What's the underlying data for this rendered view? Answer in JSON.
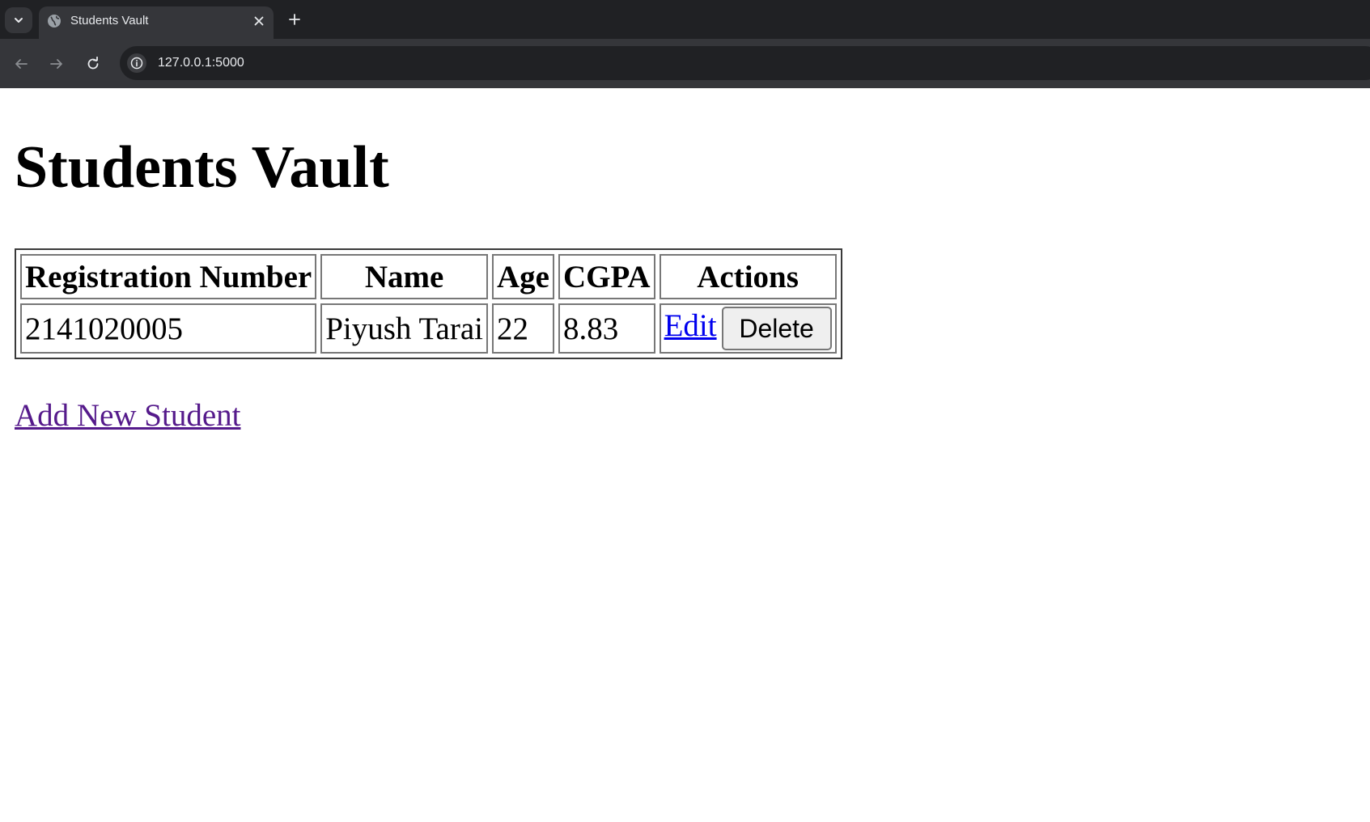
{
  "browser": {
    "tab_title": "Students Vault",
    "url": "127.0.0.1:5000",
    "icons": {
      "tab_list": "chevron-down-icon",
      "favicon": "globe-icon",
      "close": "close-icon",
      "new_tab": "plus-icon",
      "back": "arrow-left-icon",
      "forward": "arrow-right-icon",
      "reload": "reload-icon",
      "site_info": "info-icon"
    }
  },
  "page": {
    "title": "Students Vault",
    "table": {
      "headers": [
        "Registration Number",
        "Name",
        "Age",
        "CGPA",
        "Actions"
      ],
      "rows": [
        {
          "registration_number": "2141020005",
          "name": "Piyush Tarai",
          "age": "22",
          "cgpa": "8.83",
          "edit_label": "Edit",
          "delete_label": "Delete"
        }
      ]
    },
    "add_link": "Add New Student"
  },
  "colors": {
    "link": "#0000ee",
    "visited_link": "#551a8b",
    "chrome_dark": "#202124",
    "chrome_toolbar": "#35363a"
  }
}
